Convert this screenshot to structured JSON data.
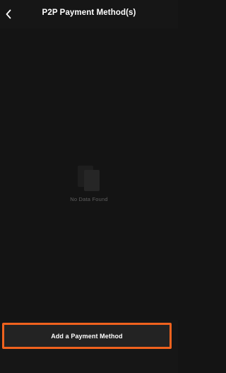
{
  "header": {
    "back_icon": "chevron-left-icon",
    "title": "P2P Payment Method(s)"
  },
  "empty_state": {
    "icon": "empty-documents-icon",
    "message": "No Data Found"
  },
  "footer": {
    "add_button_label": "Add a Payment Method"
  },
  "colors": {
    "background": "#141414",
    "header_background": "#161616",
    "button_background": "#232323",
    "highlight_border": "#f0621e",
    "text_primary": "#ffffff",
    "text_muted": "#5e5e5e"
  }
}
